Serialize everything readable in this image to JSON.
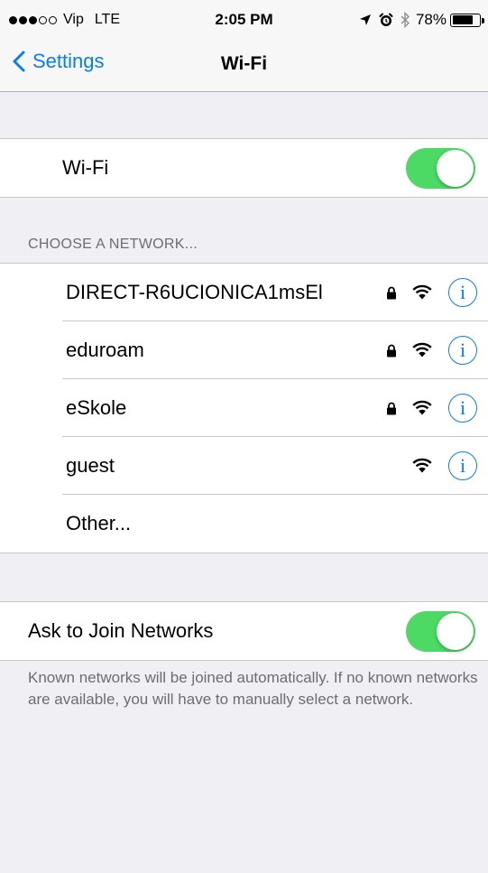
{
  "status_bar": {
    "carrier": "Vip",
    "network": "LTE",
    "time": "2:05 PM",
    "battery": "78%",
    "battery_level": 0.78,
    "signal_bars": 3,
    "signal_total": 5
  },
  "nav": {
    "back_label": "Settings",
    "title": "Wi-Fi"
  },
  "wifi_toggle": {
    "label": "Wi-Fi",
    "on": true
  },
  "networks_section": {
    "header": "CHOOSE A NETWORK...",
    "networks": [
      {
        "name": "DIRECT-R6UCIONICA1msEl",
        "locked": true
      },
      {
        "name": "eduroam",
        "locked": true
      },
      {
        "name": "eSkole",
        "locked": true
      },
      {
        "name": "guest",
        "locked": false
      }
    ],
    "other_label": "Other..."
  },
  "ask_to_join": {
    "label": "Ask to Join Networks",
    "on": true,
    "footer": "Known networks will be joined automatically. If no known networks are available, you will have to manually select a network."
  },
  "colors": {
    "accent": "#0a7aff",
    "toggle_on": "#4cd964",
    "background": "#efeff4",
    "secondary_text": "#6d6d72"
  }
}
